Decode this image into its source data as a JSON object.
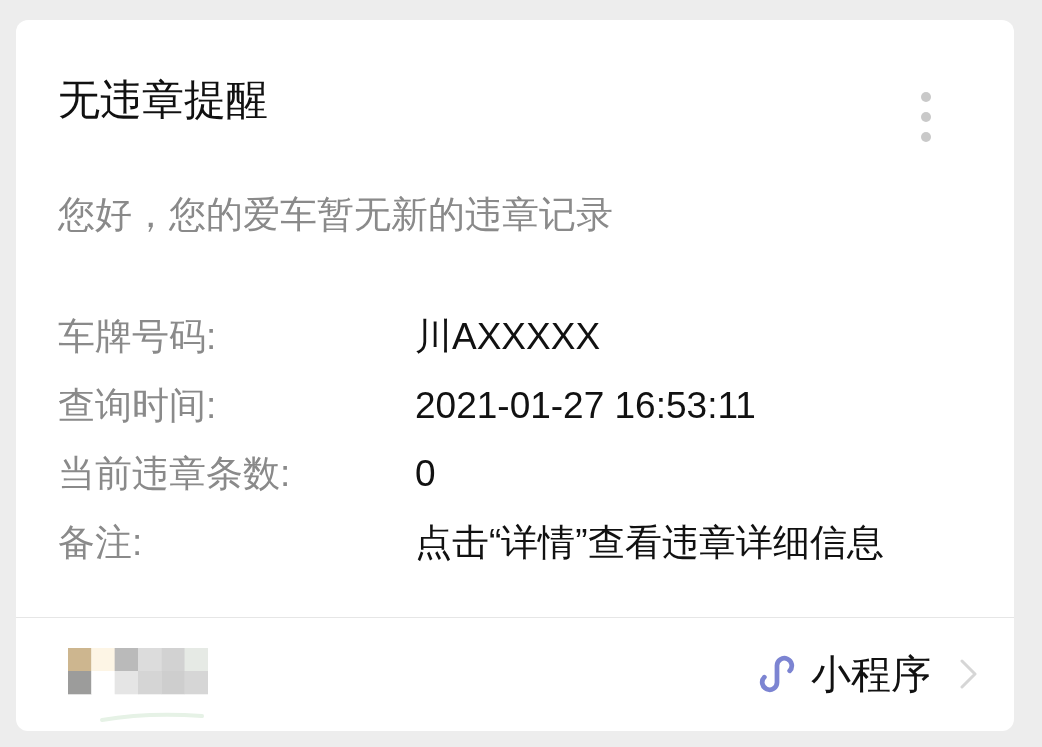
{
  "card": {
    "title": "无违章提醒",
    "message": "您好，您的爱车暂无新的违章记录",
    "fields": [
      {
        "label": "车牌号码:",
        "value": "川AXXXXX"
      },
      {
        "label": "查询时间:",
        "value": "2021-01-27 16:53:11"
      },
      {
        "label": "当前违章条数:",
        "value": "0"
      },
      {
        "label": "备注:",
        "value": "点击“详情”查看违章详细信息"
      }
    ],
    "footer": {
      "source": "小程序"
    }
  }
}
